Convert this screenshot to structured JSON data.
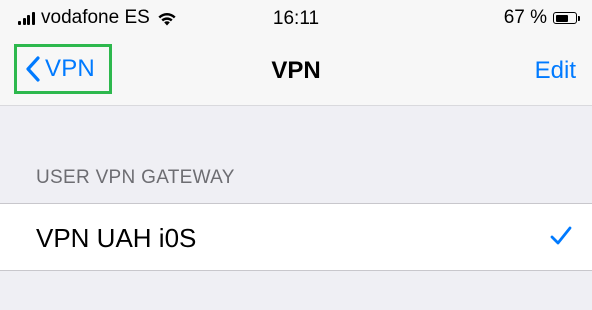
{
  "status_bar": {
    "carrier": "vodafone ES",
    "time": "16:11",
    "battery_percent": "67 %",
    "battery_level": 0.67,
    "icons": [
      "signal-icon",
      "wifi-icon",
      "battery-icon"
    ]
  },
  "nav": {
    "back_label": "VPN",
    "title": "VPN",
    "edit_label": "Edit"
  },
  "section": {
    "header": "USER VPN GATEWAY",
    "items": [
      {
        "label": "VPN UAH i0S",
        "selected": true
      }
    ]
  },
  "colors": {
    "accent": "#007aff",
    "highlight_box": "#2db84d",
    "background": "#efeff4"
  }
}
